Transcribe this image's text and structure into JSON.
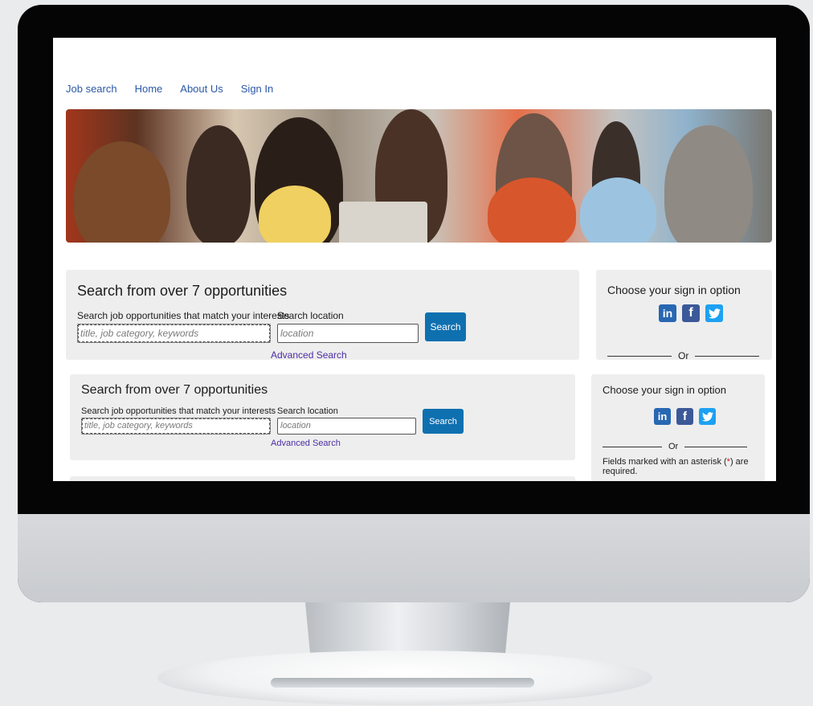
{
  "nav": {
    "items": [
      "Job search",
      "Home",
      "About Us",
      "Sign In"
    ]
  },
  "search": {
    "title": "Search from over 7 opportunities",
    "keywords_label": "Search job opportunities that match your interests",
    "keywords_placeholder": "title, job category, keywords",
    "location_label": "Search location",
    "location_placeholder": "location",
    "button": "Search",
    "advanced": "Advanced Search"
  },
  "signin": {
    "title": "Choose your sign in option",
    "or": "Or",
    "required_prefix": "Fields marked with an asterisk (",
    "required_asterisk": "*",
    "required_suffix": ") are required.",
    "social": [
      "linkedin-icon",
      "facebook-icon",
      "twitter-icon"
    ]
  },
  "colors": {
    "brand_blue": "#0f70b0",
    "link": "#2b58a6",
    "panel": "#eeeeee"
  }
}
